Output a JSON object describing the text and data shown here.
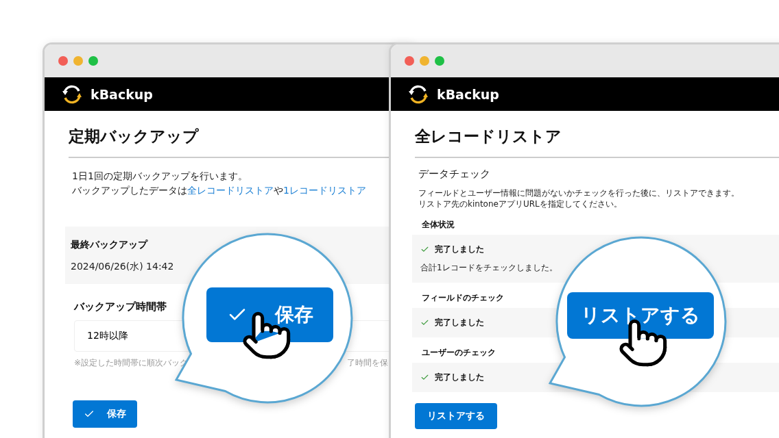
{
  "windows": [
    {
      "app_name": "kBackup",
      "title": "定期バックアップ",
      "description": [
        [
          {
            "kind": "text",
            "text": "1日1回の定期バックアップを行います。"
          }
        ],
        [
          {
            "kind": "text",
            "text": "バックアップしたデータは"
          },
          {
            "kind": "link",
            "text": "全レコードリストア"
          },
          {
            "kind": "text",
            "text": "や"
          },
          {
            "kind": "link",
            "text": "1レコードリストア"
          }
        ]
      ],
      "last_backup": {
        "label": "最終バックアップ",
        "value": "2024/06/26(水) 14:42"
      },
      "time_slot": {
        "label": "バックアップ時間帯",
        "value": "12時以降",
        "hint_parts": [
          "※設定した時間帯に順次バック",
          "了時間を保"
        ]
      },
      "button": {
        "label": "保存",
        "kind": "check"
      }
    },
    {
      "app_name": "kBackup",
      "title": "全レコードリストア",
      "section": "データチェック",
      "description_lines": [
        "フィールドとユーザー情報に問題がないかチェックを行った後に、リストアできます。",
        "リストア先のkintoneアプリURLを指定してください。"
      ],
      "checks": [
        {
          "label": "全体状況",
          "status": "完了しました",
          "detail": "合計1レコードをチェックしました。"
        },
        {
          "label": "フィールドのチェック",
          "status": "完了しました"
        },
        {
          "label": "ユーザーのチェック",
          "status": "完了しました"
        }
      ],
      "button": {
        "label": "リストアする",
        "kind": "plain"
      }
    }
  ],
  "callouts": [
    {
      "button_label": "保存",
      "kind": "check"
    },
    {
      "button_label": "リストアする",
      "kind": "plain"
    }
  ]
}
